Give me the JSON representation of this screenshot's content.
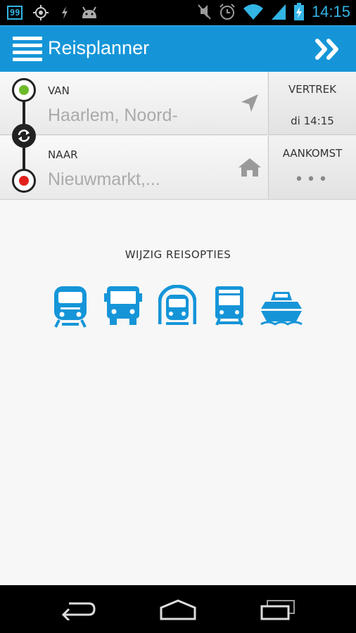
{
  "status_bar": {
    "notification_badge": "99",
    "time": "14:15",
    "icons": [
      "gps-icon",
      "usb-icon",
      "android-icon",
      "mute-icon",
      "alarm-icon",
      "wifi-icon",
      "signal-icon",
      "battery-charging-icon"
    ]
  },
  "action_bar": {
    "title": "Reisplanner",
    "color": "#1595d8"
  },
  "planner": {
    "from": {
      "label": "VAN",
      "value": "Haarlem, Noord-",
      "dot_color": "#6dbb2a"
    },
    "to": {
      "label": "NAAR",
      "value": "Nieuwmarkt,...",
      "dot_color": "#e3211b"
    },
    "departure": {
      "label": "VERTREK",
      "value": "di 14:15"
    },
    "arrival": {
      "label": "AANKOMST",
      "value": "•••"
    }
  },
  "options": {
    "title": "WIJZIG REISOPTIES",
    "transport_modes": [
      "train-icon",
      "bus-icon",
      "metro-icon",
      "tram-icon",
      "ferry-icon"
    ],
    "icon_color": "#1595d8"
  },
  "nav_bar": {
    "buttons": [
      "back-icon",
      "home-icon",
      "recent-apps-icon"
    ]
  }
}
